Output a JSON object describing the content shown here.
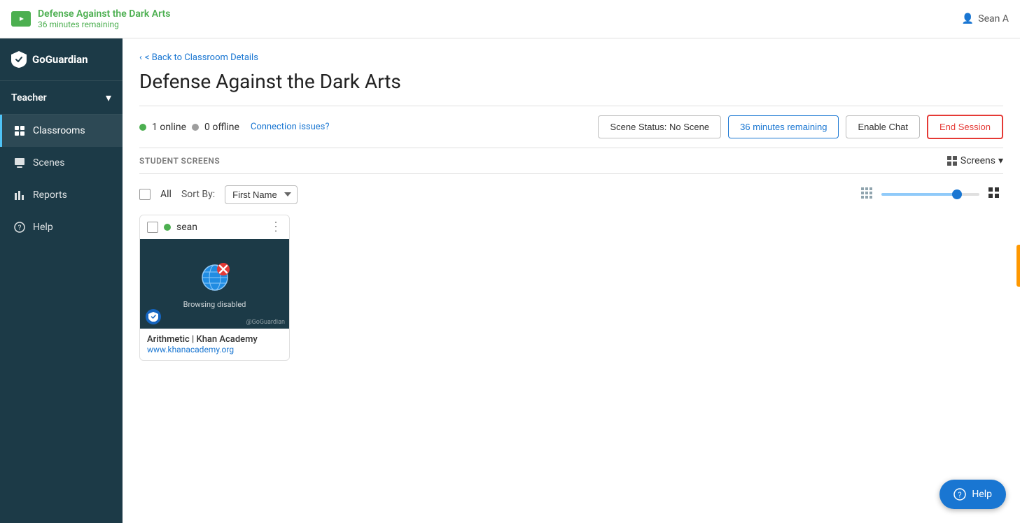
{
  "topbar": {
    "session_icon": "▶",
    "title": "Defense Against the Dark Arts",
    "subtitle": "36 minutes remaining",
    "user": "Sean A"
  },
  "sidebar": {
    "logo_text": "GoGuardian",
    "teacher_label": "Teacher",
    "items": [
      {
        "id": "classrooms",
        "label": "Classrooms",
        "icon": "⊡",
        "active": true
      },
      {
        "id": "scenes",
        "label": "Scenes",
        "icon": "◫",
        "active": false
      },
      {
        "id": "reports",
        "label": "Reports",
        "icon": "▦",
        "active": false
      },
      {
        "id": "help",
        "label": "Help",
        "icon": "●",
        "active": false
      }
    ]
  },
  "content": {
    "back_link": "< Back to Classroom Details",
    "page_title": "Defense Against the Dark Arts",
    "status": {
      "online_count": "1 online",
      "offline_count": "0 offline",
      "connection_issues": "Connection issues?",
      "scene_status": "Scene Status: No Scene",
      "time_remaining": "36 minutes remaining",
      "enable_chat": "Enable Chat",
      "end_session": "End Session"
    },
    "student_screens_label": "STUDENT SCREENS",
    "screens_dropdown": "Screens",
    "controls": {
      "all_label": "All",
      "sort_label": "Sort By:",
      "sort_value": "First Name"
    },
    "students": [
      {
        "name": "sean",
        "online": true,
        "screen_text": "Browsing disabled",
        "site_title": "Arithmetic | Khan Academy",
        "site_url": "www.khanacademy.org"
      }
    ]
  },
  "help_button": "Help"
}
